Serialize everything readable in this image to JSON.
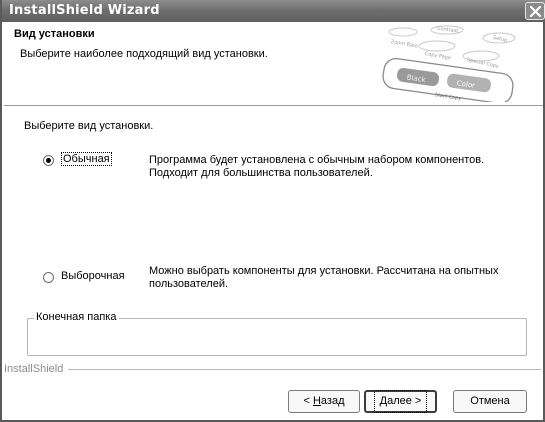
{
  "window": {
    "title": "InstallShield Wizard"
  },
  "header": {
    "title": "Вид установки",
    "subtitle": "Выберите наиболее подходящий вид установки.",
    "art_labels": [
      "Contrast",
      "Zoom Rate",
      "Copy Page",
      "Setup",
      "Special Copy",
      "Black",
      "Color",
      "Start Copy"
    ]
  },
  "prompt": "Выберите вид установки.",
  "options": [
    {
      "label": "Обычная",
      "selected": true,
      "description_line1": "Программа будет установлена с обычным набором компонентов.",
      "description_line2": "Подходит для большинства пользователей."
    },
    {
      "label": "Выборочная",
      "selected": false,
      "description_line1": "Можно выбрать компоненты для установки. Рассчитана на опытных",
      "description_line2": "пользователей."
    }
  ],
  "destination": {
    "legend": "Конечная папка",
    "value": ""
  },
  "brand": "InstallShield",
  "buttons": {
    "back_prefix": "< ",
    "back_accel": "Н",
    "back_rest": "азад",
    "next_accel": "Д",
    "next_rest": "алее >",
    "cancel": "Отмена"
  },
  "colors": {
    "titlebar": "#6e6e6e",
    "title_text": "#ffffff",
    "background": "#ffffff"
  }
}
